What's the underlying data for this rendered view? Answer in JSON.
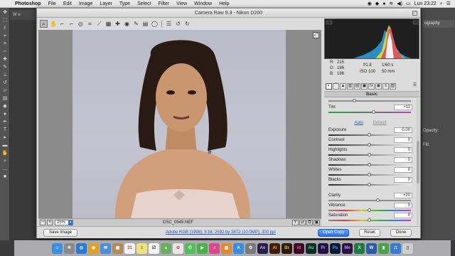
{
  "menubar": {
    "app": "Photoshop",
    "items": [
      "File",
      "Edit",
      "Image",
      "Layer",
      "Type",
      "Select",
      "Filter",
      "View",
      "Window",
      "Help"
    ],
    "clock": "Lun 23:22"
  },
  "ps": {
    "tab_label": "W e",
    "panel_option": "ography",
    "opacity_label": "Opacity:",
    "fill_label": "Fill:"
  },
  "dialog": {
    "title": "Camera Raw 9.3  -  Nikon D200",
    "filename": "DSC_0545.NEF",
    "zoom": "25%",
    "workflow_link": "Adobe RGB (1998); 8 bit; 2592 by 3872 (10.0MP); 300 ppi",
    "buttons": {
      "save": "Save Image",
      "open": "Open Copy",
      "reset": "Reset",
      "done": "Done"
    }
  },
  "info": {
    "r_label": "R:",
    "r_value": "215",
    "g_label": "G:",
    "g_value": "186",
    "b_label": "B:",
    "b_value": "186",
    "aperture": "f/1.8",
    "shutter": "1/60 s",
    "iso": "ISO 100",
    "focal": "50 mm"
  },
  "panel": {
    "title": "Basic",
    "auto": "Auto",
    "default": "Default",
    "sliders": [
      {
        "label": "Tint",
        "value": "+11",
        "level": 0.55
      },
      {
        "label": "Exposure",
        "value": "0.00",
        "level": 0.5
      },
      {
        "label": "Contrast",
        "value": "0",
        "level": 0.5
      },
      {
        "label": "Highlights",
        "value": "0",
        "level": 0.5
      },
      {
        "label": "Shadows",
        "value": "0",
        "level": 0.5
      },
      {
        "label": "Whites",
        "value": "0",
        "level": 0.5
      },
      {
        "label": "Blacks",
        "value": "0",
        "level": 0.5
      },
      {
        "label": "Clarity",
        "value": "+20",
        "level": 0.6
      },
      {
        "label": "Vibrance",
        "value": "0",
        "level": 0.5
      },
      {
        "label": "Saturation",
        "value": "0",
        "level": 0.5
      }
    ]
  },
  "dock": {
    "apps": [
      "Finder",
      "Launchpad",
      "Safari",
      "Chrome",
      "Mail",
      "Contacts",
      "Calendar",
      "Notes",
      "Reminders",
      "Maps",
      "Photos",
      "Messages",
      "FaceTime",
      "iTunes",
      "iBooks",
      "App Store",
      "System Preferences",
      "Ae",
      "Ai",
      "Br",
      "Id",
      "Au",
      "Pr",
      "Ps",
      "Me",
      "Excel",
      "Word",
      "Numbers",
      "Keynote",
      "Trash"
    ]
  }
}
